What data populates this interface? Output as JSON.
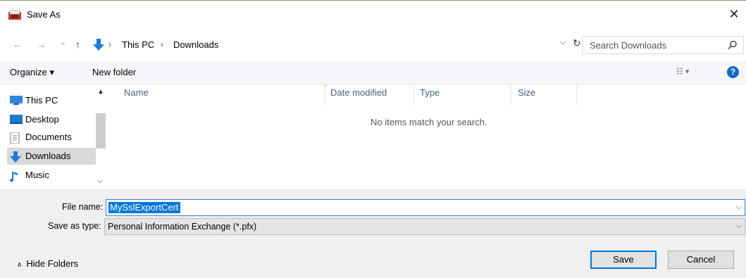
{
  "window": {
    "title": "Save As",
    "close_glyph": "✕"
  },
  "address": {
    "back_glyph": "←",
    "forward_glyph": "→",
    "recent_glyph": "⌄",
    "up_glyph": "↑",
    "separator": "›",
    "crumbs": [
      "This PC",
      "Downloads"
    ],
    "dropdown_glyph": "⌵",
    "refresh_glyph": "↻"
  },
  "search": {
    "placeholder": "Search Downloads"
  },
  "toolbar": {
    "organize_label": "Organize ▾",
    "new_folder_label": "New folder",
    "views_glyph": "☷ ▾",
    "help_glyph": "?"
  },
  "nav": {
    "items": [
      {
        "label": "This PC",
        "icon": "computer-icon"
      },
      {
        "label": "Desktop",
        "icon": "desktop-folder-icon"
      },
      {
        "label": "Documents",
        "icon": "documents-icon"
      },
      {
        "label": "Downloads",
        "icon": "downloads-icon",
        "selected": true
      },
      {
        "label": "Music",
        "icon": "music-icon"
      }
    ],
    "scroll_up_glyph": "▲",
    "scroll_down_glyph": "⌵"
  },
  "list": {
    "columns": [
      "Name",
      "Date modified",
      "Type",
      "Size"
    ],
    "sort_glyph": "⌄",
    "empty_message": "No items match your search."
  },
  "form": {
    "file_name_label": "File name:",
    "file_name_value": "MySslExportCert",
    "save_type_label": "Save as type:",
    "save_type_value": "Personal Information Exchange (*.pfx)",
    "dropdown_glyph": "⌵"
  },
  "footer": {
    "hide_folders_label": "Hide Folders",
    "hide_folders_glyph": "∧",
    "save_label": "Save",
    "cancel_label": "Cancel"
  },
  "colors": {
    "accent": "#0078d7",
    "toolbar_bg": "#f4f6f9",
    "bottom_bg": "#f0f0f0",
    "header_text": "#4c607a"
  }
}
